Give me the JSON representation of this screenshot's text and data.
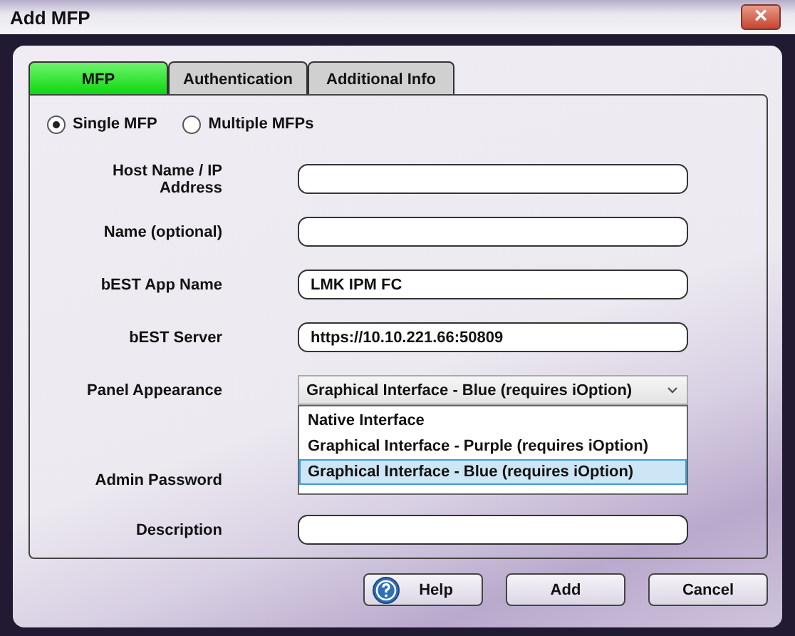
{
  "window": {
    "title": "Add MFP",
    "close": "×"
  },
  "tabs": [
    {
      "label": "MFP",
      "selected": true
    },
    {
      "label": "Authentication",
      "selected": false
    },
    {
      "label": "Additional Info",
      "selected": false
    }
  ],
  "mode": [
    {
      "label": "Single MFP",
      "selected": true
    },
    {
      "label": "Multiple MFPs",
      "selected": false
    }
  ],
  "fields": [
    {
      "kind": "text",
      "label": "Host Name / IP Address"
    },
    {
      "kind": "text",
      "label": "Name (optional)"
    },
    {
      "kind": "text",
      "label": "bEST App Name",
      "value": "LMK IPM FC"
    },
    {
      "kind": "text",
      "label": "bEST Server",
      "value": "https://10.10.221.66:50809"
    },
    {
      "kind": "dropdown",
      "label": "Panel Appearance",
      "value": "Graphical Interface - Blue (requires iOption)",
      "expanded": true,
      "options": [
        {
          "label": "Native Interface",
          "selected": false
        },
        {
          "label": "Graphical Interface - Purple (requires iOption)",
          "selected": false
        },
        {
          "label": "Graphical Interface - Blue (requires iOption)",
          "selected": true
        }
      ]
    },
    {
      "kind": "text",
      "label": "Admin Password"
    },
    {
      "kind": "text",
      "label": "Description"
    }
  ],
  "buttons": [
    {
      "label": "Help",
      "kind": "help"
    },
    {
      "label": "Add",
      "kind": "plain"
    },
    {
      "label": "Cancel",
      "kind": "plain"
    }
  ]
}
